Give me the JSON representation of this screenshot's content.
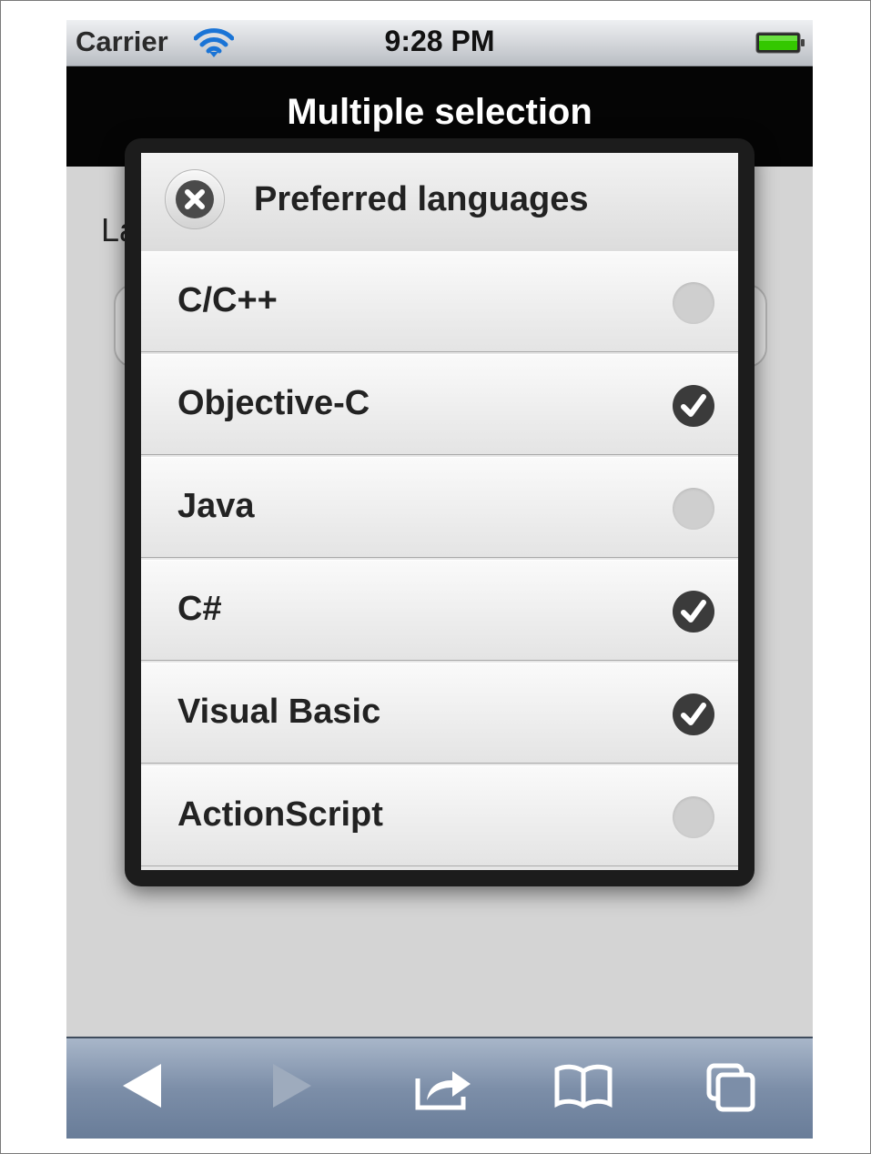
{
  "status_bar": {
    "carrier": "Carrier",
    "time": "9:28 PM",
    "wifi_icon": "wifi-icon",
    "battery_icon": "battery-icon",
    "battery_color": "#34c800"
  },
  "header": {
    "title": "Multiple selection"
  },
  "background": {
    "label": "La"
  },
  "dialog": {
    "title": "Preferred languages",
    "close_icon": "close-icon",
    "options": [
      {
        "label": "C/C++",
        "checked": false
      },
      {
        "label": "Objective-C",
        "checked": true
      },
      {
        "label": "Java",
        "checked": false
      },
      {
        "label": "C#",
        "checked": true
      },
      {
        "label": "Visual Basic",
        "checked": true
      },
      {
        "label": "ActionScript",
        "checked": false
      }
    ]
  },
  "toolbar": {
    "buttons": [
      {
        "icon": "back-arrow-icon",
        "enabled": true
      },
      {
        "icon": "forward-arrow-icon",
        "enabled": false
      },
      {
        "icon": "share-icon",
        "enabled": true
      },
      {
        "icon": "bookmarks-icon",
        "enabled": true
      },
      {
        "icon": "tabs-icon",
        "enabled": true
      }
    ]
  }
}
